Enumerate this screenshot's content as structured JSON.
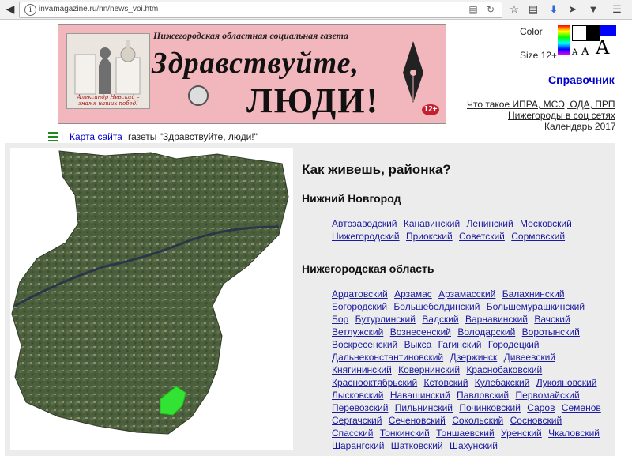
{
  "browser": {
    "url": "invamagazine.ru/nn/news_voi.htm",
    "info_glyph": "i"
  },
  "banner": {
    "top_line": "Нижегородская областная социальная газета",
    "title_line1": "Здравствуйте,",
    "title_line2": "ЛЮДИ!",
    "age_badge": "12+",
    "photo_caption": "Александр Невский – знамя наших побед!"
  },
  "controls": {
    "color_label": "Color",
    "size_label": "Size 12+",
    "size_small_a": "A",
    "size_mid_a": "A",
    "size_large_a": "A"
  },
  "right_links": {
    "spravochnik": "Справочник",
    "ipra": "Что такое ИПРА, МСЭ, ОДА, ПРП",
    "social": "Нижегороды в соц сетях",
    "calendar": "Календарь 2017"
  },
  "breadcrumb": {
    "separator": "|",
    "link": "Карта сайта",
    "text": "газеты \"Здравствуйте, люди!\""
  },
  "main": {
    "heading": "Как живешь, районка?",
    "city_heading": "Нижний Новгород",
    "city_districts": [
      "Автозаводский",
      "Канавинский",
      "Ленинский",
      "Московский",
      "Нижегородский",
      "Приокский",
      "Советский",
      "Сормовский"
    ],
    "oblast_heading": "Нижегородская область",
    "oblast_districts": [
      "Ардатовский",
      "Арзамас",
      "Арзамасский",
      "Балахнинский",
      "Богородский",
      "Большеболдинский",
      "Большемурашкинский",
      "Бор",
      "Бутурлинский",
      "Вадский",
      "Варнавинский",
      "Вачский",
      "Ветлужский",
      "Вознесенский",
      "Володарский",
      "Воротынский",
      "Воскресенский",
      "Выкса",
      "Гагинский",
      "Городецкий",
      "Дальнеконстантиновский",
      "Дзержинск",
      "Дивеевский",
      "Княгининский",
      "Ковернинский",
      "Краснобаковский",
      "Краснооктябрьский",
      "Кстовский",
      "Кулебакский",
      "Лукояновский",
      "Лысковский",
      "Навашинский",
      "Павловский",
      "Первомайский",
      "Перевозский",
      "Пильнинский",
      "Починковский",
      "Саров",
      "Семенов",
      "Сергачский",
      "Сеченовский",
      "Сокольский",
      "Сосновский",
      "Спасский",
      "Тонкинский",
      "Тоншаевский",
      "Уренский",
      "Чкаловский",
      "Шарангский",
      "Шатковский",
      "Шахунский"
    ]
  },
  "icons": {
    "back": "back-arrow-icon",
    "info": "info-icon",
    "reader": "reader-view-icon",
    "reload": "reload-icon",
    "bookmark": "bookmark-star-icon",
    "library": "library-icon",
    "download": "download-icon",
    "send": "send-icon",
    "pocket": "pocket-icon",
    "menu": "hamburger-menu-icon"
  },
  "colors": {
    "banner_bg": "#f2b7bd",
    "link": "#1a1aa0",
    "highlight_region": "#33e333"
  }
}
